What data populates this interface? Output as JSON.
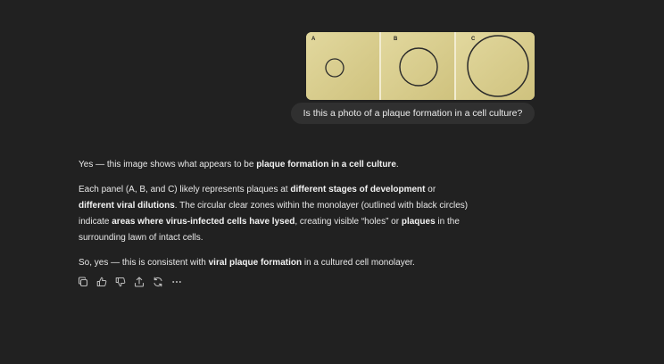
{
  "user": {
    "image_panels": [
      "A",
      "B",
      "C"
    ],
    "message": "Is this a photo of a plaque formation in a cell culture?"
  },
  "assistant": {
    "p1": {
      "t1": "Yes — this image shows what appears to be ",
      "b1": "plaque formation in a cell culture",
      "t2": "."
    },
    "p2": {
      "t1": "Each panel (A, B, and C) likely represents plaques at ",
      "b1": "different stages of development",
      "t2": " or ",
      "b2": "different viral dilutions",
      "t3": ". The circular clear zones within the monolayer (outlined with black circles) indicate ",
      "b3": "areas where virus-infected cells have lysed",
      "t4": ", creating visible “holes” or ",
      "b4": "plaques",
      "t5": " in the surrounding lawn of intact cells."
    },
    "p3": {
      "t1": "So, yes — this is consistent with ",
      "b1": "viral plaque formation",
      "t2": " in a cultured cell monolayer."
    }
  },
  "actions": [
    {
      "icon": "copy-icon"
    },
    {
      "icon": "thumbs-up-icon"
    },
    {
      "icon": "thumbs-down-icon"
    },
    {
      "icon": "share-icon"
    },
    {
      "icon": "regenerate-icon"
    },
    {
      "icon": "more-icon"
    }
  ]
}
